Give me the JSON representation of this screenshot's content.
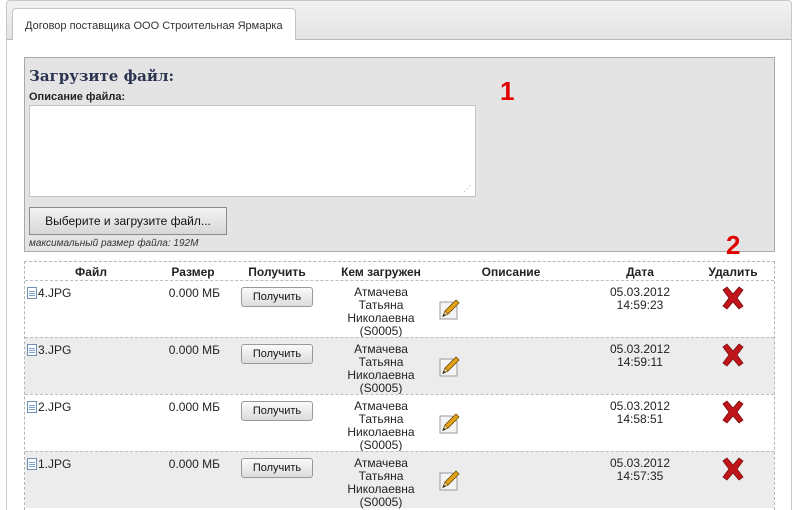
{
  "tab": {
    "label": "Договор поставщика ООО Строительная Ярмарка"
  },
  "upload": {
    "title": "Загрузите файл:",
    "description_label": "Описание файла:",
    "description_value": "",
    "button_label": "Выберите и загрузите файл...",
    "max_size_note": "максимальный размер файла: 192M"
  },
  "markers": {
    "one": "1",
    "two": "2"
  },
  "table": {
    "headers": {
      "file": "Файл",
      "size": "Размер",
      "get": "Получить",
      "uploaded_by": "Кем загружен",
      "description": "Описание",
      "date": "Дата",
      "delete": "Удалить"
    },
    "rows": [
      {
        "file": "4.JPG",
        "size": "0.000 МБ",
        "get_label": "Получить",
        "uploader_line1": "Атмачева",
        "uploader_line2": "Татьяна",
        "uploader_line3": "Николаевна",
        "uploader_line4": "(S0005)",
        "description": "",
        "date": "05.03.2012",
        "time": "14:59:23"
      },
      {
        "file": "3.JPG",
        "size": "0.000 МБ",
        "get_label": "Получить",
        "uploader_line1": "Атмачева",
        "uploader_line2": "Татьяна",
        "uploader_line3": "Николаевна",
        "uploader_line4": "(S0005)",
        "description": "",
        "date": "05.03.2012",
        "time": "14:59:11"
      },
      {
        "file": "2.JPG",
        "size": "0.000 МБ",
        "get_label": "Получить",
        "uploader_line1": "Атмачева",
        "uploader_line2": "Татьяна",
        "uploader_line3": "Николаевна",
        "uploader_line4": "(S0005)",
        "description": "",
        "date": "05.03.2012",
        "time": "14:58:51"
      },
      {
        "file": "1.JPG",
        "size": "0.000 МБ",
        "get_label": "Получить",
        "uploader_line1": "Атмачева",
        "uploader_line2": "Татьяна",
        "uploader_line3": "Николаевна",
        "uploader_line4": "(S0005)",
        "description": "",
        "date": "05.03.2012",
        "time": "14:57:35"
      }
    ]
  },
  "icons": {
    "file": "file-icon",
    "edit": "pencil-edit-icon",
    "delete": "red-x-delete-icon"
  },
  "colors": {
    "marker": "#e00000",
    "delete": "#c0161b",
    "upload_bg": "#e4e4e4",
    "row_alt": "#ececec"
  }
}
